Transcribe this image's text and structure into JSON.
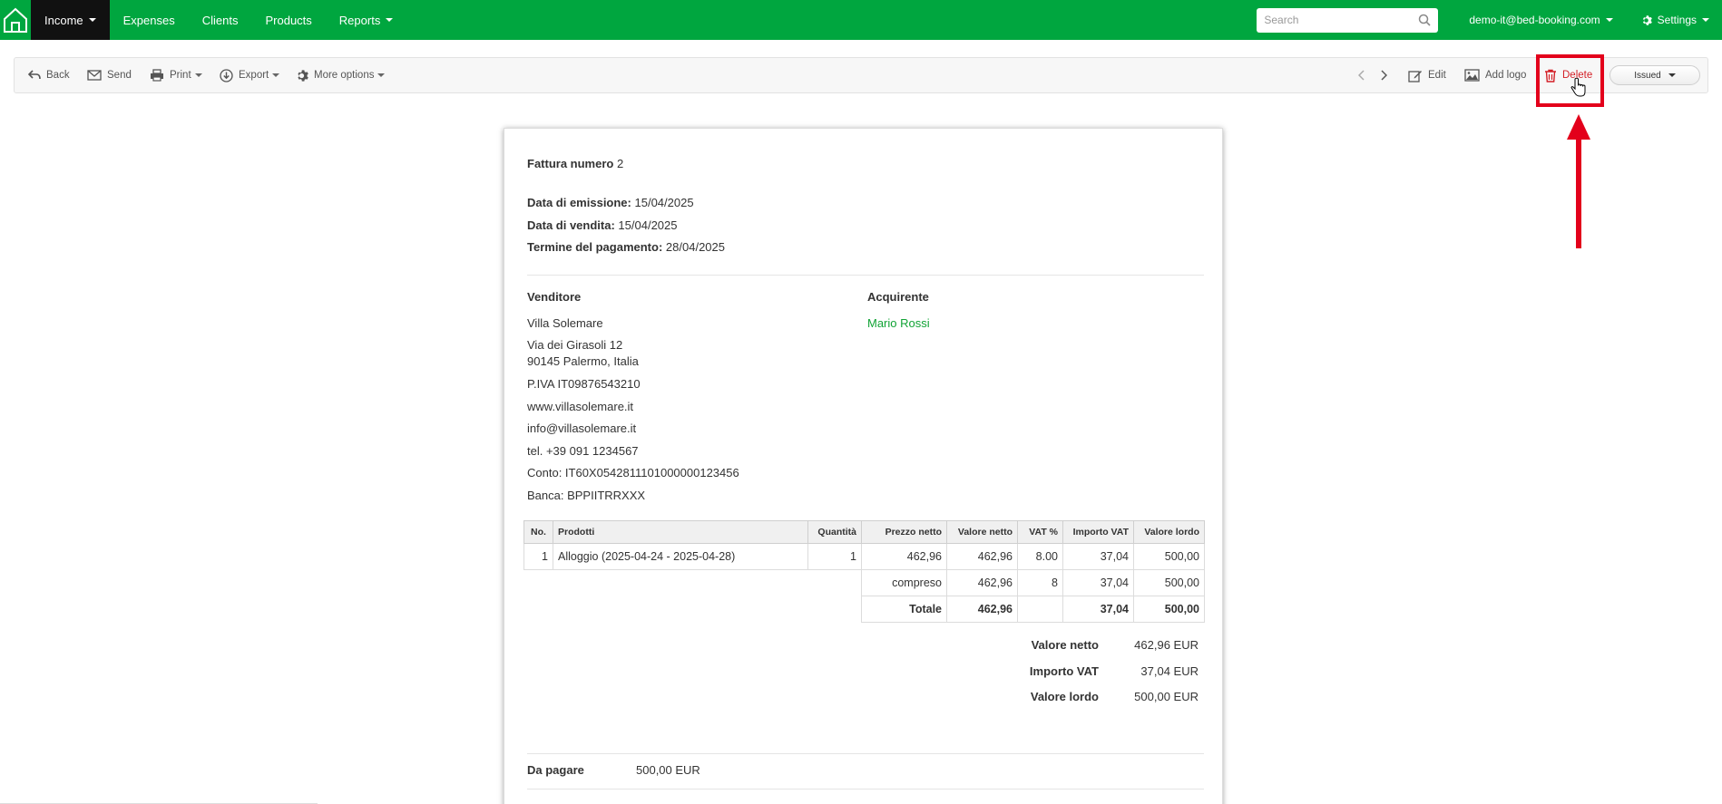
{
  "nav": {
    "items": [
      {
        "label": "Income"
      },
      {
        "label": "Expenses"
      },
      {
        "label": "Clients"
      },
      {
        "label": "Products"
      },
      {
        "label": "Reports"
      }
    ],
    "search_placeholder": "Search",
    "user": "demo-it@bed-booking.com",
    "settings": "Settings"
  },
  "toolbar": {
    "back": "Back",
    "send": "Send",
    "print": "Print",
    "export": "Export",
    "more_options": "More options",
    "edit": "Edit",
    "add_logo": "Add logo",
    "delete": "Delete",
    "status": "Issued"
  },
  "colors": {
    "navbar": "#00a63f",
    "accent_green": "#11a335",
    "delete_red": "#d31f26",
    "highlight_red": "#e3001b"
  },
  "invoice": {
    "title_label": "Fattura numero",
    "number": "2",
    "issue_date_label": "Data di emissione:",
    "issue_date": "15/04/2025",
    "sale_date_label": "Data di vendita:",
    "sale_date": "15/04/2025",
    "payment_due_label": "Termine del pagamento:",
    "payment_due": "28/04/2025",
    "seller_heading": "Venditore",
    "buyer_heading": "Acquirente",
    "seller": {
      "name": "Villa Solemare",
      "address1": "Via dei Girasoli 12",
      "address2": "90145 Palermo, Italia",
      "vat": "P.IVA IT09876543210",
      "website": "www.villasolemare.it",
      "email": "info@villasolemare.it",
      "phone": "tel. +39 091 1234567",
      "account": "Conto: IT60X0542811101000000123456",
      "bank": "Banca: BPPIITRRXXX"
    },
    "buyer": {
      "name": "Mario Rossi"
    },
    "table": {
      "headers": [
        "No.",
        "Prodotti",
        "Quantità",
        "Prezzo netto",
        "Valore netto",
        "VAT %",
        "Importo VAT",
        "Valore lordo"
      ],
      "rows": [
        {
          "no": "1",
          "product": "Alloggio (2025-04-24 - 2025-04-28)",
          "qty": "1",
          "net_price": "462,96",
          "net_value": "462,96",
          "vat_pct": "8.00",
          "vat_amount": "37,04",
          "gross": "500,00"
        }
      ],
      "vat_row": {
        "label": "compreso",
        "net_value": "462,96",
        "vat_pct": "8",
        "vat_amount": "37,04",
        "gross": "500,00"
      },
      "total_row": {
        "label": "Totale",
        "net_value": "462,96",
        "vat_pct": "",
        "vat_amount": "37,04",
        "gross": "500,00"
      }
    },
    "summary": {
      "net_label": "Valore netto",
      "net_value": "462,96 EUR",
      "vat_label": "Importo VAT",
      "vat_value": "37,04 EUR",
      "gross_label": "Valore lordo",
      "gross_value": "500,00 EUR"
    },
    "to_pay_label": "Da pagare",
    "to_pay_value": "500,00 EUR"
  }
}
